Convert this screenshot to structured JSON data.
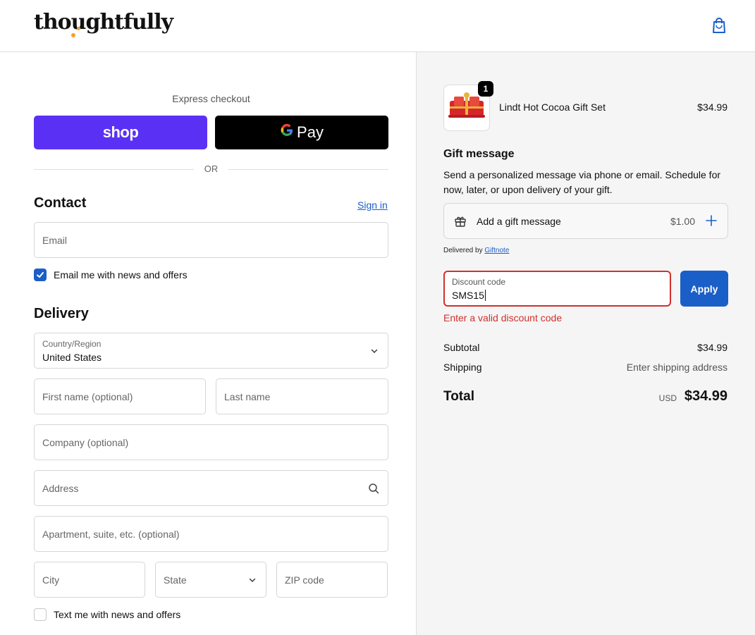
{
  "header": {
    "logo_text": "thoughtfully",
    "cart_icon": "shopping-bag-icon"
  },
  "express": {
    "label": "Express checkout",
    "shop_label": "shop",
    "gpay_label": "Pay",
    "divider_text": "OR"
  },
  "contact": {
    "title": "Contact",
    "signin_label": "Sign in",
    "email_placeholder": "Email",
    "newsletter_label": "Email me with news and offers",
    "newsletter_checked": true
  },
  "delivery": {
    "title": "Delivery",
    "country_label": "Country/Region",
    "country_value": "United States",
    "first_name_placeholder": "First name (optional)",
    "last_name_placeholder": "Last name",
    "company_placeholder": "Company (optional)",
    "address_placeholder": "Address",
    "apartment_placeholder": "Apartment, suite, etc. (optional)",
    "city_placeholder": "City",
    "state_placeholder": "State",
    "zip_placeholder": "ZIP code",
    "sms_label": "Text me with news and offers",
    "sms_checked": false
  },
  "order": {
    "product_name": "Lindt Hot Cocoa Gift Set",
    "product_price": "$34.99",
    "quantity": "1"
  },
  "gift": {
    "title": "Gift message",
    "description": "Send a personalized message via phone or email. Schedule for now, later, or upon delivery of your gift.",
    "add_label": "Add a gift message",
    "add_price": "$1.00",
    "delivered_by": "Delivered by",
    "delivered_link": "Giftnote"
  },
  "discount": {
    "label": "Discount code",
    "value": "SMS15",
    "apply_label": "Apply",
    "error": "Enter a valid discount code"
  },
  "summary": {
    "subtotal_label": "Subtotal",
    "subtotal_value": "$34.99",
    "shipping_label": "Shipping",
    "shipping_value": "Enter shipping address",
    "total_label": "Total",
    "currency": "USD",
    "total_value": "$34.99"
  },
  "colors": {
    "shop_purple": "#5a31f4",
    "link_blue": "#1a5fc8",
    "error_red": "#d0312d",
    "summary_bg": "#f5f5f5"
  }
}
